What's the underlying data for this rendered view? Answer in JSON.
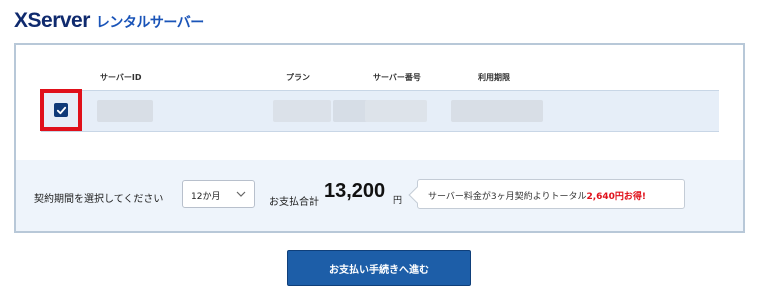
{
  "brand": {
    "name": "XServer",
    "subtitle": "レンタルサーバー"
  },
  "table": {
    "columns": [
      "サーバーID",
      "プラン",
      "サーバー番号",
      "利用期限"
    ],
    "row": {
      "checked": true
    }
  },
  "period": {
    "label": "契約期間を選択してください",
    "selected": "12か月"
  },
  "total": {
    "label": "お支払合計",
    "amount": "13,200",
    "unit": "円"
  },
  "promo": {
    "text": "サーバー料金が3ヶ月契約よりトータル",
    "highlight": "2,640円お得!"
  },
  "proceed_button": {
    "label": "お支払い手続きへ進む"
  },
  "colors": {
    "brand_navy": "#0f2a6e",
    "brand_blue": "#1a54b8",
    "button_blue": "#1d5ea8",
    "highlight_red": "#e0101a",
    "checkbox_navy": "#0f3a78"
  }
}
